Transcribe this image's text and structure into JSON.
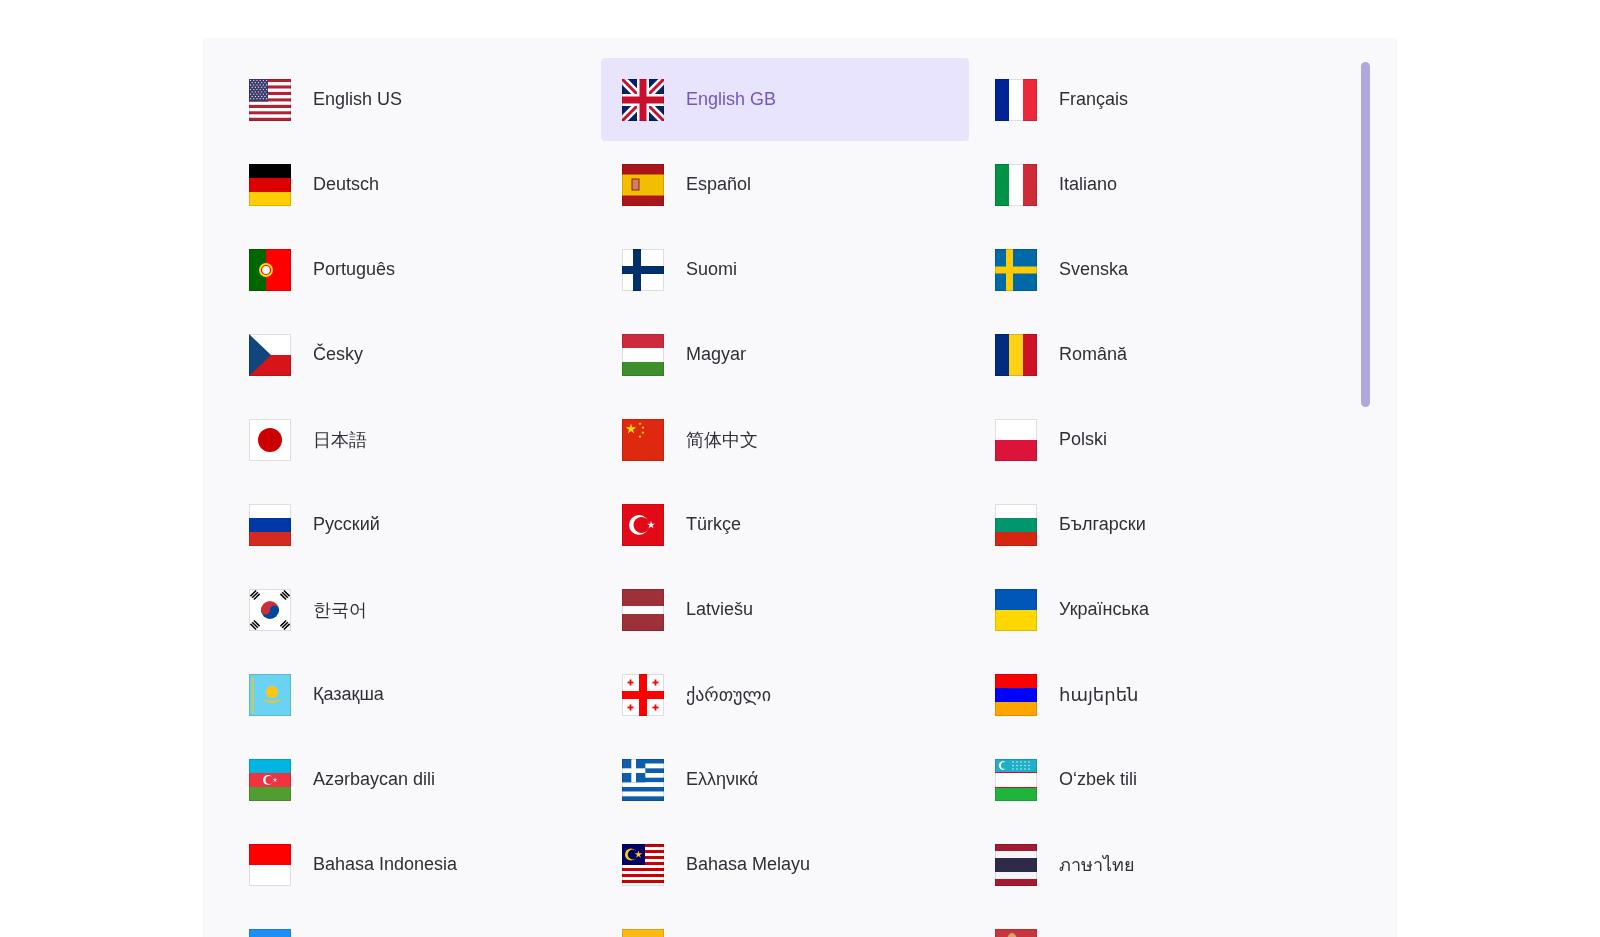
{
  "languages": [
    {
      "label": "English US",
      "kind": "us",
      "selected": false
    },
    {
      "label": "English GB",
      "kind": "gb",
      "selected": true
    },
    {
      "label": "Français",
      "kind": "fr",
      "selected": false
    },
    {
      "label": "Deutsch",
      "kind": "de",
      "selected": false
    },
    {
      "label": "Español",
      "kind": "es",
      "selected": false
    },
    {
      "label": "Italiano",
      "kind": "it",
      "selected": false
    },
    {
      "label": "Português",
      "kind": "pt",
      "selected": false
    },
    {
      "label": "Suomi",
      "kind": "fi",
      "selected": false
    },
    {
      "label": "Svenska",
      "kind": "se",
      "selected": false
    },
    {
      "label": "Česky",
      "kind": "cz",
      "selected": false
    },
    {
      "label": "Magyar",
      "kind": "hu",
      "selected": false
    },
    {
      "label": "Română",
      "kind": "ro",
      "selected": false
    },
    {
      "label": "日本語",
      "kind": "jp",
      "selected": false
    },
    {
      "label": "简体中文",
      "kind": "cn",
      "selected": false
    },
    {
      "label": "Polski",
      "kind": "pl",
      "selected": false
    },
    {
      "label": "Русский",
      "kind": "ru",
      "selected": false
    },
    {
      "label": "Türkçe",
      "kind": "tr",
      "selected": false
    },
    {
      "label": "Български",
      "kind": "bg",
      "selected": false
    },
    {
      "label": "한국어",
      "kind": "kr",
      "selected": false
    },
    {
      "label": "Latviešu",
      "kind": "lv",
      "selected": false
    },
    {
      "label": "Українська",
      "kind": "ua",
      "selected": false
    },
    {
      "label": "Қазақша",
      "kind": "kz",
      "selected": false
    },
    {
      "label": "ქართული",
      "kind": "ge",
      "selected": false
    },
    {
      "label": "հայերեն",
      "kind": "am",
      "selected": false
    },
    {
      "label": "Azərbaycan dili",
      "kind": "az",
      "selected": false
    },
    {
      "label": "Ελληνικά",
      "kind": "gr",
      "selected": false
    },
    {
      "label": "O‘zbek tili",
      "kind": "uz",
      "selected": false
    },
    {
      "label": "Bahasa Indonesia",
      "kind": "id",
      "selected": false
    },
    {
      "label": "Bahasa Melayu",
      "kind": "my",
      "selected": false
    },
    {
      "label": "ภาษาไทย",
      "kind": "th",
      "selected": false
    },
    {
      "kind": "ee",
      "selected": false
    },
    {
      "kind": "lt",
      "selected": false
    },
    {
      "kind": "rs",
      "selected": false
    }
  ]
}
